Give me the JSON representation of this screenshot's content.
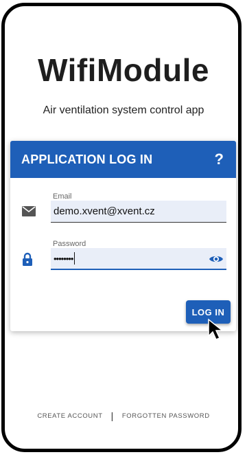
{
  "app": {
    "title": "WifiModule",
    "subtitle": "Air ventilation system control app"
  },
  "login_card": {
    "title": "APPLICATION LOG IN",
    "help_label": "?",
    "email": {
      "label": "Email",
      "value": "demo.xvent@xvent.cz",
      "icon": "envelope-icon"
    },
    "password": {
      "label": "Password",
      "masked_value": "••••••••",
      "icon": "lock-icon",
      "toggle_icon": "eye-icon"
    },
    "login_button": "LOG IN"
  },
  "footer": {
    "create_account": "CREATE ACCOUNT",
    "separator": "|",
    "forgotten_password": "FORGOTTEN PASSWORD"
  },
  "colors": {
    "primary": "#1e5fb8",
    "field_bg": "#e9eef8",
    "title_text": "#1e1e1e"
  }
}
